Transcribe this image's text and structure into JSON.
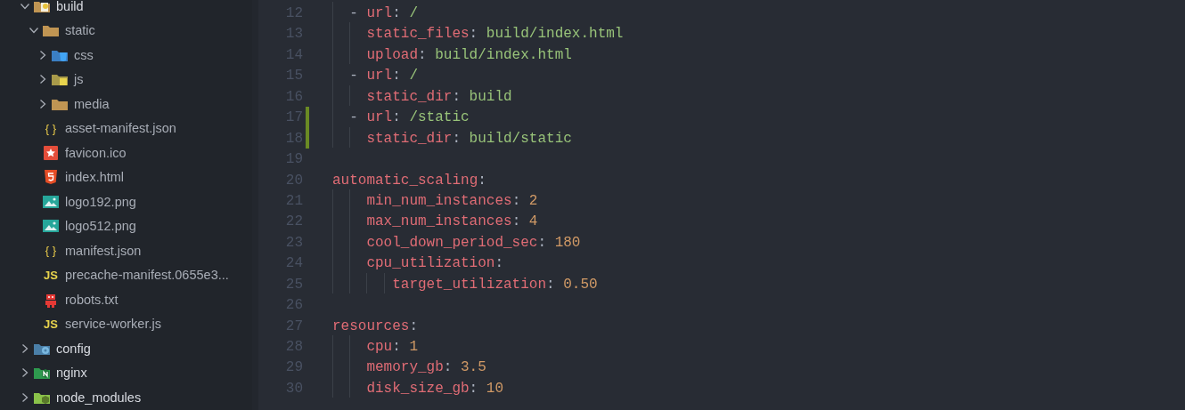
{
  "explorer": {
    "tree": [
      {
        "label": "build",
        "kind": "folder-build",
        "expanded": true,
        "children": [
          {
            "label": "static",
            "kind": "folder",
            "expanded": true,
            "children": [
              {
                "label": "css",
                "kind": "folder-css",
                "expanded": false
              },
              {
                "label": "js",
                "kind": "folder-js",
                "expanded": false
              },
              {
                "label": "media",
                "kind": "folder",
                "expanded": false
              }
            ]
          },
          {
            "label": "asset-manifest.json",
            "kind": "json",
            "badge": "{ }"
          },
          {
            "label": "favicon.ico",
            "kind": "favicon"
          },
          {
            "label": "index.html",
            "kind": "html"
          },
          {
            "label": "logo192.png",
            "kind": "image"
          },
          {
            "label": "logo512.png",
            "kind": "image"
          },
          {
            "label": "manifest.json",
            "kind": "json",
            "badge": "{ }"
          },
          {
            "label": "precache-manifest.0655e3...",
            "kind": "js",
            "badge": "JS"
          },
          {
            "label": "robots.txt",
            "kind": "robot"
          },
          {
            "label": "service-worker.js",
            "kind": "js",
            "badge": "JS"
          }
        ]
      },
      {
        "label": "config",
        "kind": "folder-config",
        "expanded": false
      },
      {
        "label": "nginx",
        "kind": "folder-nginx",
        "expanded": false
      },
      {
        "label": "node_modules",
        "kind": "folder-node",
        "expanded": false
      }
    ]
  },
  "editor": {
    "lines": [
      {
        "number": "12",
        "kind": "item",
        "modified": false,
        "tokens": [
          {
            "kind": "dash",
            "text": "-"
          },
          {
            "kind": "key",
            "text": "url"
          },
          {
            "kind": "punct",
            "text": ":"
          },
          {
            "kind": "string",
            "text": "/"
          }
        ]
      },
      {
        "number": "13",
        "kind": "field",
        "modified": false,
        "tokens": [
          {
            "kind": "key",
            "text": "static_files"
          },
          {
            "kind": "punct",
            "text": ":"
          },
          {
            "kind": "string",
            "text": "build/index.html"
          }
        ]
      },
      {
        "number": "14",
        "kind": "field",
        "modified": false,
        "tokens": [
          {
            "kind": "key",
            "text": "upload"
          },
          {
            "kind": "punct",
            "text": ":"
          },
          {
            "kind": "string",
            "text": "build/index.html"
          }
        ]
      },
      {
        "number": "15",
        "kind": "item",
        "modified": false,
        "tokens": [
          {
            "kind": "dash",
            "text": "-"
          },
          {
            "kind": "key",
            "text": "url"
          },
          {
            "kind": "punct",
            "text": ":"
          },
          {
            "kind": "string",
            "text": "/"
          }
        ]
      },
      {
        "number": "16",
        "kind": "field",
        "modified": false,
        "tokens": [
          {
            "kind": "key",
            "text": "static_dir"
          },
          {
            "kind": "punct",
            "text": ":"
          },
          {
            "kind": "string",
            "text": "build"
          }
        ]
      },
      {
        "number": "17",
        "kind": "item",
        "modified": true,
        "tokens": [
          {
            "kind": "dash",
            "text": "-"
          },
          {
            "kind": "key",
            "text": "url"
          },
          {
            "kind": "punct",
            "text": ":"
          },
          {
            "kind": "string",
            "text": "/static"
          }
        ]
      },
      {
        "number": "18",
        "kind": "field",
        "modified": true,
        "tokens": [
          {
            "kind": "key",
            "text": "static_dir"
          },
          {
            "kind": "punct",
            "text": ":"
          },
          {
            "kind": "string",
            "text": "build/static"
          }
        ]
      },
      {
        "number": "19",
        "kind": "blank",
        "modified": false
      },
      {
        "number": "20",
        "kind": "top",
        "modified": false,
        "tokens": [
          {
            "kind": "key",
            "text": "automatic_scaling"
          },
          {
            "kind": "punct",
            "text": ":"
          }
        ]
      },
      {
        "number": "21",
        "kind": "field",
        "modified": false,
        "tokens": [
          {
            "kind": "key",
            "text": "min_num_instances"
          },
          {
            "kind": "punct",
            "text": ":"
          },
          {
            "kind": "number",
            "text": "2"
          }
        ]
      },
      {
        "number": "22",
        "kind": "field",
        "modified": false,
        "tokens": [
          {
            "kind": "key",
            "text": "max_num_instances"
          },
          {
            "kind": "punct",
            "text": ":"
          },
          {
            "kind": "number",
            "text": "4"
          }
        ]
      },
      {
        "number": "23",
        "kind": "field",
        "modified": false,
        "tokens": [
          {
            "kind": "key",
            "text": "cool_down_period_sec"
          },
          {
            "kind": "punct",
            "text": ":"
          },
          {
            "kind": "number",
            "text": "180"
          }
        ]
      },
      {
        "number": "24",
        "kind": "field",
        "modified": false,
        "tokens": [
          {
            "kind": "key",
            "text": "cpu_utilization"
          },
          {
            "kind": "punct",
            "text": ":"
          }
        ]
      },
      {
        "number": "25",
        "kind": "nested",
        "modified": false,
        "tokens": [
          {
            "kind": "key",
            "text": "target_utilization"
          },
          {
            "kind": "punct",
            "text": ":"
          },
          {
            "kind": "number",
            "text": "0.50"
          }
        ]
      },
      {
        "number": "26",
        "kind": "blank",
        "modified": false
      },
      {
        "number": "27",
        "kind": "top",
        "modified": false,
        "tokens": [
          {
            "kind": "key",
            "text": "resources"
          },
          {
            "kind": "punct",
            "text": ":"
          }
        ]
      },
      {
        "number": "28",
        "kind": "field",
        "modified": false,
        "tokens": [
          {
            "kind": "key",
            "text": "cpu"
          },
          {
            "kind": "punct",
            "text": ":"
          },
          {
            "kind": "number",
            "text": "1"
          }
        ]
      },
      {
        "number": "29",
        "kind": "field",
        "modified": false,
        "tokens": [
          {
            "kind": "key",
            "text": "memory_gb"
          },
          {
            "kind": "punct",
            "text": ":"
          },
          {
            "kind": "number",
            "text": "3.5"
          }
        ]
      },
      {
        "number": "30",
        "kind": "field",
        "modified": false,
        "tokens": [
          {
            "kind": "key",
            "text": "disk_size_gb"
          },
          {
            "kind": "punct",
            "text": ":"
          },
          {
            "kind": "number",
            "text": "10"
          }
        ]
      }
    ]
  }
}
